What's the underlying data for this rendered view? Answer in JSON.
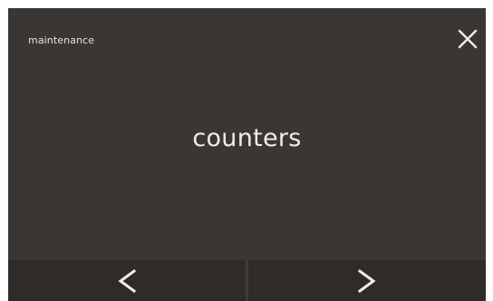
{
  "header": {
    "title": "maintenance",
    "close_icon": "close-icon"
  },
  "main": {
    "label": "counters"
  },
  "nav": {
    "prev_icon": "chevron-left-icon",
    "next_icon": "chevron-right-icon"
  },
  "colors": {
    "background": "#3a3633",
    "nav_background": "#2e2b29",
    "text": "#f0ece8"
  }
}
